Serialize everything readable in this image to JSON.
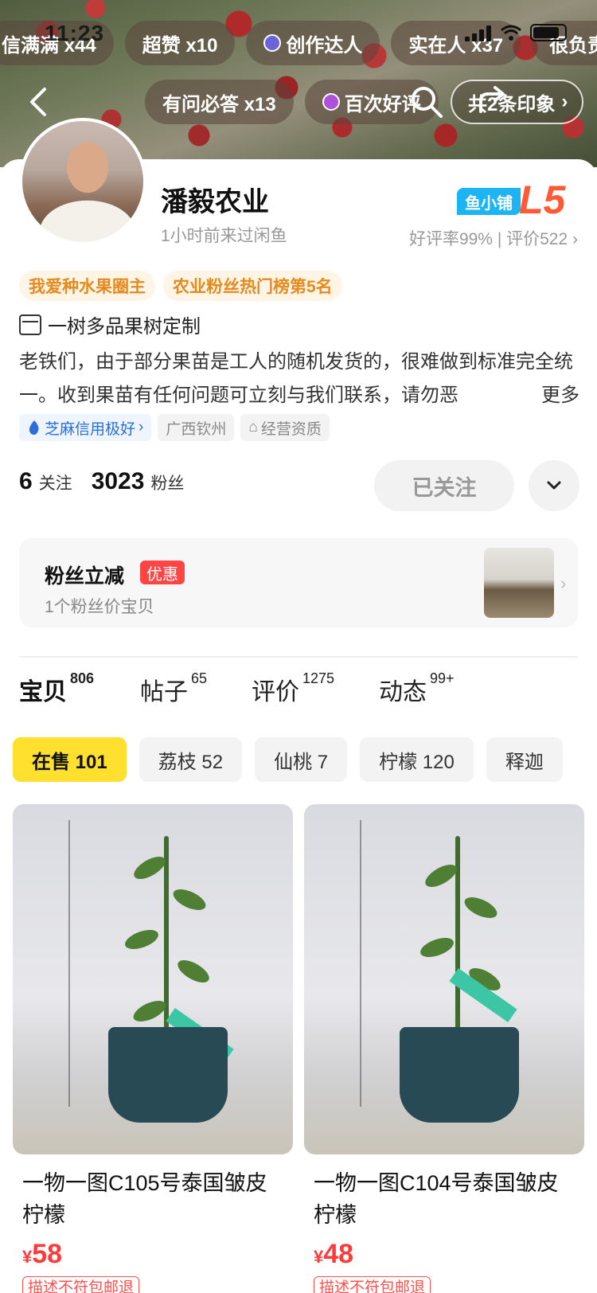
{
  "status_bar": {
    "time": "11:23"
  },
  "banner_badges_row1": [
    "信满满 x44",
    "超赞 x10",
    "创作达人",
    "实在人 x37",
    "很负责"
  ],
  "banner_badges_row2": [
    "有问必答 x13",
    "百次好评"
  ],
  "impression_label": "共2条印象",
  "shop": {
    "name": "潘毅农业",
    "last_seen": "1小时前来过闲鱼",
    "shop_tag": "鱼小铺",
    "level": "L5",
    "rating_text": "好评率99% | 评价522",
    "honors": [
      "我爱种水果圈主",
      "农业粉丝热门榜第5名"
    ],
    "customize_text": "一树多品果树定制",
    "bio": "老铁们，由于部分果苗是工人的随机发货的，很难做到标准完全统一。收到果苗有任何问题可立刻与我们联系，请勿恶",
    "bio_more": "更多",
    "credit_chip": "芝麻信用极好",
    "location_chip": "广西钦州",
    "qualification_chip": "经营资质",
    "follow_count": "6",
    "follow_label": "关注",
    "fans_count": "3023",
    "fans_label": "粉丝",
    "followed_button": "已关注"
  },
  "fan_discount": {
    "title": "粉丝立减",
    "tag": "优惠",
    "subtitle": "1个粉丝价宝贝"
  },
  "tabs": [
    {
      "label": "宝贝",
      "count": "806"
    },
    {
      "label": "帖子",
      "count": "65"
    },
    {
      "label": "评价",
      "count": "1275"
    },
    {
      "label": "动态",
      "count": "99+"
    }
  ],
  "filters": [
    "在售 101",
    "荔枝 52",
    "仙桃 7",
    "柠檬 120",
    "释迦"
  ],
  "products": [
    {
      "title": "一物一图C105号泰国皱皮柠檬",
      "currency": "¥",
      "price": "58",
      "badge": "描述不符包邮退"
    },
    {
      "title": "一物一图C104号泰国皱皮柠檬",
      "currency": "¥",
      "price": "48",
      "badge": "描述不符包邮退"
    }
  ],
  "colors": {
    "accent_yellow": "#ffe02e",
    "price_red": "#ff3a3a",
    "level_orange": "#ff5a36",
    "honor_orange": "#e58a1c"
  }
}
